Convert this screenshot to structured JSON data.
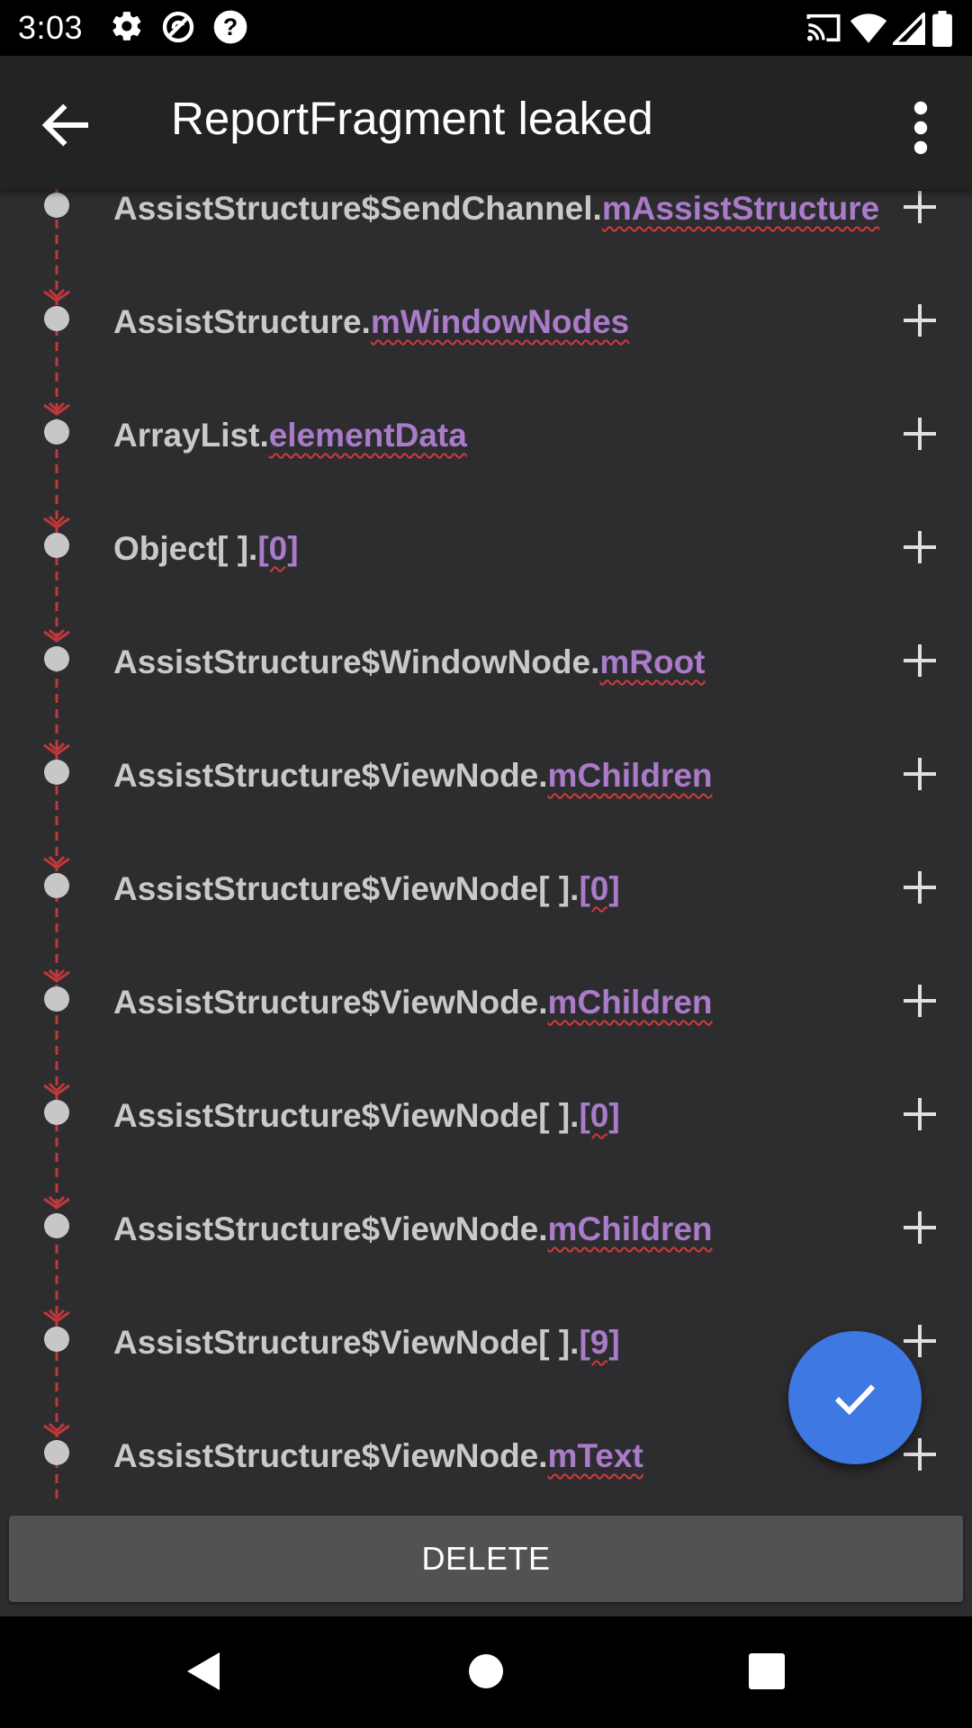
{
  "status_bar": {
    "time": "3:03",
    "left_icons": [
      "settings-icon",
      "no-disturb-icon",
      "help-icon"
    ],
    "right_icons": [
      "cast-icon",
      "wifi-icon",
      "signal-icon",
      "battery-icon"
    ]
  },
  "app_bar": {
    "title": "ReportFragment leaked",
    "back_icon": "arrow-back-icon",
    "overflow_icon": "more-vert-icon"
  },
  "rows": [
    {
      "class_name": "AssistStructure$SendChannel.",
      "field": "mAssistStructure"
    },
    {
      "class_name": "AssistStructure.",
      "field": "mWindowNodes"
    },
    {
      "class_name": "ArrayList.",
      "field": "elementData"
    },
    {
      "class_name": "Object[ ].",
      "field": "[0]"
    },
    {
      "class_name": "AssistStructure$WindowNode.",
      "field": "mRoot"
    },
    {
      "class_name": "AssistStructure$ViewNode.",
      "field": "mChildren"
    },
    {
      "class_name": "AssistStructure$ViewNode[ ].",
      "field": "[0]"
    },
    {
      "class_name": "AssistStructure$ViewNode.",
      "field": "mChildren"
    },
    {
      "class_name": "AssistStructure$ViewNode[ ].",
      "field": "[0]"
    },
    {
      "class_name": "AssistStructure$ViewNode.",
      "field": "mChildren"
    },
    {
      "class_name": "AssistStructure$ViewNode[ ].",
      "field": "[9]"
    },
    {
      "class_name": "AssistStructure$ViewNode.",
      "field": "mText"
    }
  ],
  "fab_icon": "check-icon",
  "delete_button": "DELETE",
  "nav_bar": [
    "back-triangle-icon",
    "home-circle-icon",
    "recents-square-icon"
  ],
  "colors": {
    "background": "#2d2d2f",
    "app_bar": "#232323",
    "field_purple": "#a97bc8",
    "leak_red": "#d03a3a",
    "fab_blue": "#3e78e3"
  }
}
